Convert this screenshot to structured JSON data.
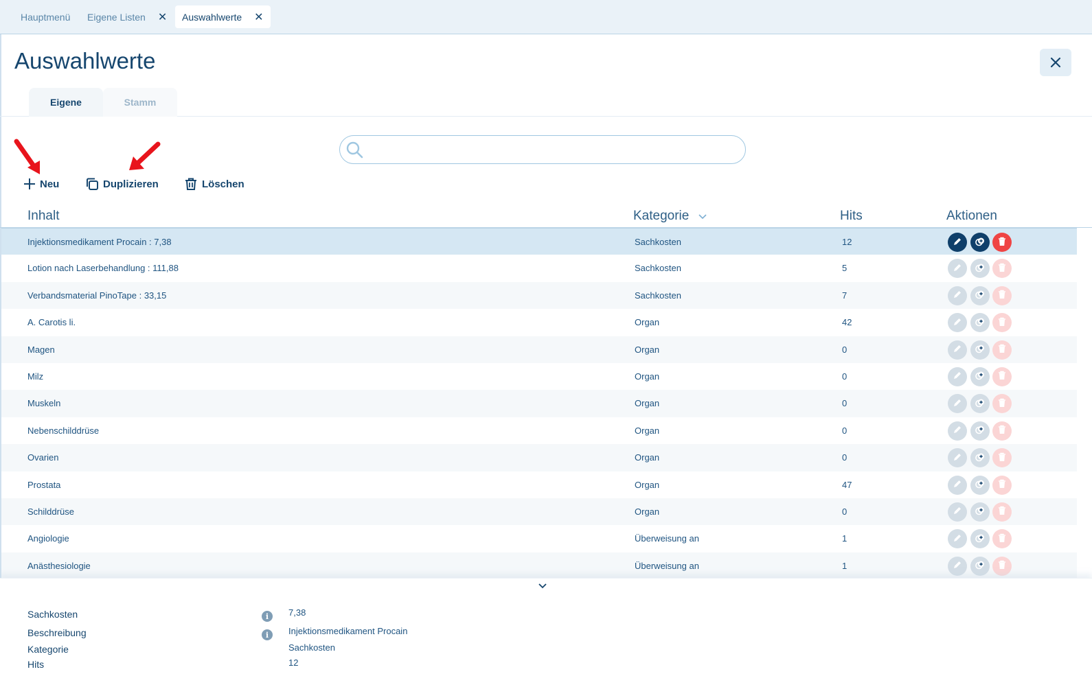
{
  "window_tabs": [
    {
      "label": "Hauptmenü"
    },
    {
      "label": "Eigene Listen"
    },
    {
      "label": "Auswahlwerte"
    }
  ],
  "page": {
    "title": "Auswahlwerte",
    "close_icon": "close-icon"
  },
  "subtabs": [
    {
      "label": "Eigene",
      "active": true
    },
    {
      "label": "Stamm",
      "active": false
    }
  ],
  "search": {
    "placeholder": "",
    "value": "",
    "icon": "search-icon"
  },
  "toolbar": {
    "new_label": "Neu",
    "duplicate_label": "Duplizieren",
    "delete_label": "Löschen"
  },
  "table": {
    "headers": {
      "inhalt": "Inhalt",
      "kategorie": "Kategorie",
      "hits": "Hits",
      "aktionen": "Aktionen"
    },
    "sort_icon": "chevron-down-icon",
    "rows": [
      {
        "inhalt": "Injektionsmedikament Procain  : 7,38",
        "kategorie": "Sachkosten",
        "hits": "12",
        "selected": true
      },
      {
        "inhalt": "Lotion nach Laserbehandlung : 111,88",
        "kategorie": "Sachkosten",
        "hits": "5"
      },
      {
        "inhalt": "Verbandsmaterial PinoTape : 33,15",
        "kategorie": "Sachkosten",
        "hits": "7"
      },
      {
        "inhalt": "A. Carotis li.",
        "kategorie": "Organ",
        "hits": "42"
      },
      {
        "inhalt": "Magen",
        "kategorie": "Organ",
        "hits": "0"
      },
      {
        "inhalt": "Milz",
        "kategorie": "Organ",
        "hits": "0"
      },
      {
        "inhalt": "Muskeln",
        "kategorie": "Organ",
        "hits": "0"
      },
      {
        "inhalt": "Nebenschilddrüse",
        "kategorie": "Organ",
        "hits": "0"
      },
      {
        "inhalt": "Ovarien",
        "kategorie": "Organ",
        "hits": "0"
      },
      {
        "inhalt": "Prostata",
        "kategorie": "Organ",
        "hits": "47"
      },
      {
        "inhalt": "Schilddrüse",
        "kategorie": "Organ",
        "hits": "0"
      },
      {
        "inhalt": "Angiologie",
        "kategorie": "Überweisung an",
        "hits": "1"
      },
      {
        "inhalt": "Anästhesiologie",
        "kategorie": "Überweisung an",
        "hits": "1"
      }
    ]
  },
  "detail": {
    "fields": [
      {
        "label": "Sachkosten",
        "value": "7,38",
        "info": true
      },
      {
        "label": "Beschreibung",
        "value": "Injektionsmedikament Procain",
        "info": true
      },
      {
        "label": "Kategorie",
        "value": "Sachkosten",
        "info": false
      },
      {
        "label": "Hits",
        "value": "12",
        "info": false
      }
    ]
  },
  "colors": {
    "primary": "#16466e",
    "selected_row": "#d5e7f3",
    "delete_red": "#ef4444",
    "annotation_arrow": "#e8141c"
  }
}
